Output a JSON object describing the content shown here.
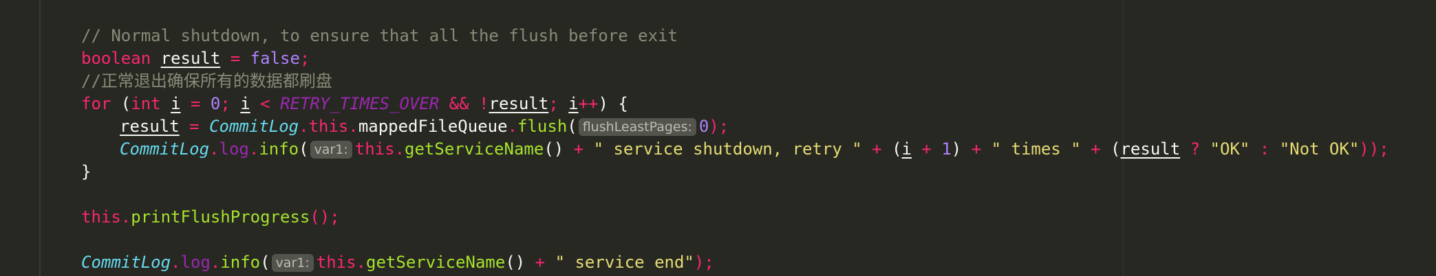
{
  "editor": {
    "theme_background": "#272822",
    "lines": [
      {
        "comment": "// Normal shutdown, to ensure that all the flush before exit"
      },
      {
        "kw_boolean": "boolean",
        "var_result": "result",
        "eq": " = ",
        "false": "false",
        "semi": ";"
      },
      {
        "comment": "//正常退出确保所有的数据都刷盘"
      },
      {
        "kw_for": "for",
        "paren_open": " (",
        "kw_int": "int",
        "var_i": "i",
        "eq": " = ",
        "zero": "0",
        "semi1": "; ",
        "var_i2": "i",
        "lt": " < ",
        "const": "RETRY_TIMES_OVER",
        "and": " && ",
        "not": "!",
        "var_result": "result",
        "semi2": "; ",
        "var_i3": "i",
        "inc": "++",
        "close": ") {"
      },
      {
        "var_result": "result",
        "eq": " = ",
        "cls": "CommitLog",
        "dot1": ".",
        "this": "this",
        "dot2": ".",
        "field": "mappedFileQueue",
        "dot3": ".",
        "method": "flush",
        "paren": "(",
        "hint": "flushLeastPages:",
        "zero": "0",
        "end": ");"
      },
      {
        "cls": "CommitLog",
        "dot1": ".",
        "field": "log",
        "dot2": ".",
        "method": "info",
        "paren": "(",
        "hint": "var1:",
        "this": "this",
        "dot3": ".",
        "method2": "getServiceName",
        "call": "()",
        "plus1": " + ",
        "str1": "\" service shutdown, retry \"",
        "plus2": " + ",
        "paren2": "(",
        "var_i": "i",
        "plus3": " + ",
        "one": "1",
        "paren3": ")",
        "plus4": " + ",
        "str2": "\" times \"",
        "plus5": " + ",
        "paren4": "(",
        "var_result": "result",
        "q": " ? ",
        "str3": "\"OK\"",
        "colon": " : ",
        "str4": "\"Not OK\"",
        "end": "));"
      },
      {
        "brace": "}"
      },
      {},
      {
        "this": "this",
        "dot": ".",
        "method": "printFlushProgress",
        "end": "();"
      },
      {},
      {
        "cls": "CommitLog",
        "dot1": ".",
        "field": "log",
        "dot2": ".",
        "method": "info",
        "paren": "(",
        "hint": "var1:",
        "this": "this",
        "dot3": ".",
        "method2": "getServiceName",
        "call": "()",
        "plus": " + ",
        "str": "\" service end\"",
        "end": ");"
      }
    ]
  }
}
